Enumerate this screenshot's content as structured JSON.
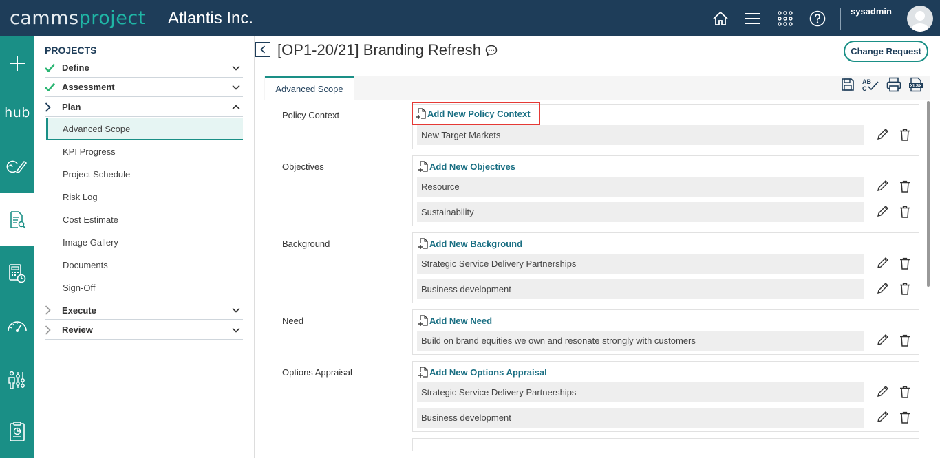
{
  "header": {
    "logo_part1": "camms",
    "logo_part2": "project",
    "tenant": "Atlantis Inc.",
    "username": "sysadmin",
    "icons": [
      "home-icon",
      "menu-icon",
      "apps-grid-icon",
      "help-icon"
    ]
  },
  "rail": {
    "hub_label": "hub",
    "items": [
      "plus-icon",
      "hub-icon",
      "refresh-edit-icon",
      "document-search-icon",
      "calculator-clock-icon",
      "gauge-icon",
      "people-chart-icon",
      "report-icon"
    ]
  },
  "nav": {
    "title": "PROJECTS",
    "sections": [
      {
        "label": "Define",
        "state": "complete"
      },
      {
        "label": "Assessment",
        "state": "complete"
      },
      {
        "label": "Plan",
        "state": "expanded"
      },
      {
        "label": "Execute",
        "state": "collapsed"
      },
      {
        "label": "Review",
        "state": "collapsed"
      }
    ],
    "plan_items": [
      "Advanced Scope",
      "KPI Progress",
      "Project Schedule",
      "Risk Log",
      "Cost Estimate",
      "Image Gallery",
      "Documents",
      "Sign-Off"
    ],
    "active_item": "Advanced Scope"
  },
  "page": {
    "title": "[OP1-20/21] Branding Refresh",
    "change_request": "Change Request",
    "tab": "Advanced Scope",
    "toolbar": [
      "save-icon",
      "spellcheck-icon",
      "print-icon",
      "xlsx-export-icon"
    ]
  },
  "fields": [
    {
      "label": "Policy Context",
      "add": "Add New Policy Context",
      "items": [
        "New Target Markets"
      ]
    },
    {
      "label": "Objectives",
      "add": "Add New Objectives",
      "items": [
        "Resource",
        "Sustainability"
      ]
    },
    {
      "label": "Background",
      "add": "Add New Background",
      "items": [
        "Strategic Service Delivery Partnerships",
        "Business development"
      ]
    },
    {
      "label": "Need",
      "add": "Add New Need",
      "items": [
        "Build on brand equities we own and resonate strongly with customers"
      ]
    },
    {
      "label": "Options Appraisal",
      "add": "Add New Options Appraisal",
      "items": [
        "Strategic Service Delivery Partnerships",
        "Business development"
      ]
    }
  ],
  "colors": {
    "header_bg": "#1e3d59",
    "rail_bg": "#1a8f86",
    "accent": "#1a8f86",
    "link": "#1a6f83",
    "highlight": "#e53935",
    "check": "#2bb673"
  }
}
